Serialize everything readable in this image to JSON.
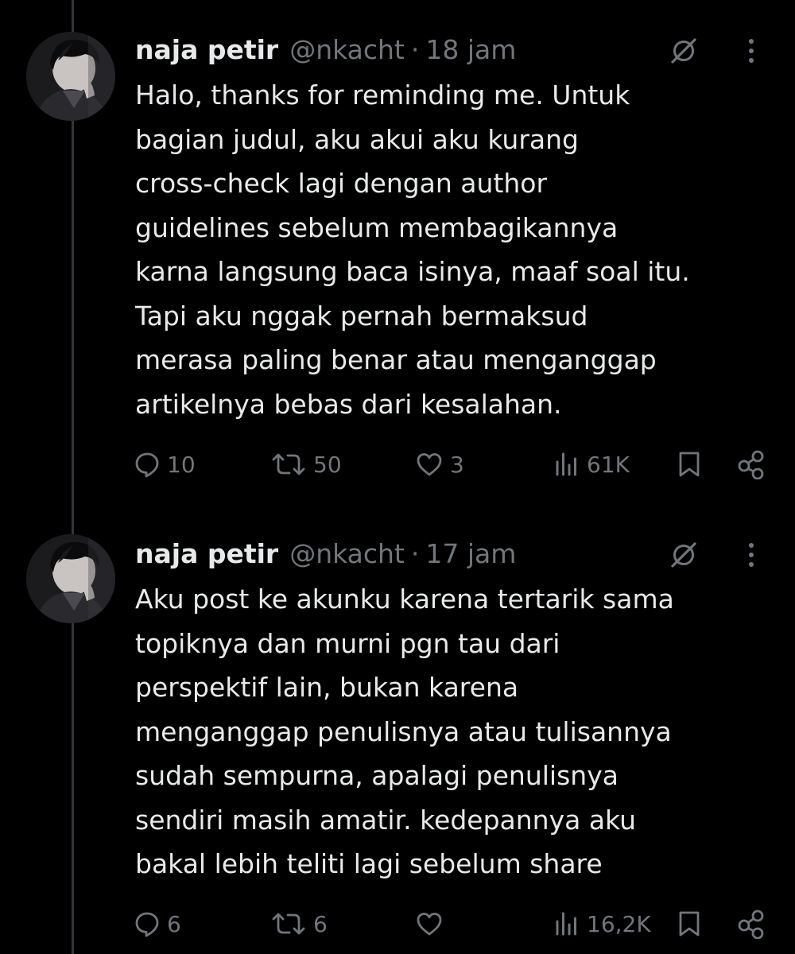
{
  "tweets": [
    {
      "author_name": "naja petir",
      "handle": "@nkacht",
      "separator": "·",
      "time": "18 jam",
      "text_lines": [
        "Halo, thanks for reminding me. Untuk",
        "bagian judul, aku akui aku kurang",
        "cross-check lagi dengan author",
        "guidelines sebelum membagikannya",
        "karna langsung baca isinya, maaf soal itu.",
        "Tapi aku nggak pernah bermaksud",
        "merasa paling benar atau menganggap",
        "artikelnya bebas dari kesalahan."
      ],
      "replies": "10",
      "reposts": "50",
      "likes": "3",
      "views": "61K",
      "icons": {
        "reply": "reply-icon",
        "repost": "repost-icon",
        "like": "heart-icon",
        "views": "views-icon",
        "bookmark": "bookmark-icon",
        "share": "share-icon",
        "grok": "grok-icon",
        "more": "more-icon"
      }
    },
    {
      "author_name": "naja petir",
      "handle": "@nkacht",
      "separator": "·",
      "time": "17 jam",
      "text_lines": [
        "Aku post ke akunku karena tertarik sama",
        "topiknya dan murni pgn tau dari",
        "perspektif lain, bukan karena",
        "menganggap penulisnya atau tulisannya",
        "sudah sempurna, apalagi penulisnya",
        "sendiri masih amatir. kedepannya aku",
        "bakal lebih teliti lagi sebelum share"
      ],
      "replies": "6",
      "reposts": "6",
      "likes": "",
      "views": "16,2K",
      "icons": {
        "reply": "reply-icon",
        "repost": "repost-icon",
        "like": "heart-icon",
        "views": "views-icon",
        "bookmark": "bookmark-icon",
        "share": "share-icon",
        "grok": "grok-icon",
        "more": "more-icon"
      }
    }
  ],
  "colors": {
    "background": "#000000",
    "text_primary": "#e7e9ea",
    "text_secondary": "#71767b",
    "thread_line": "#333639"
  }
}
